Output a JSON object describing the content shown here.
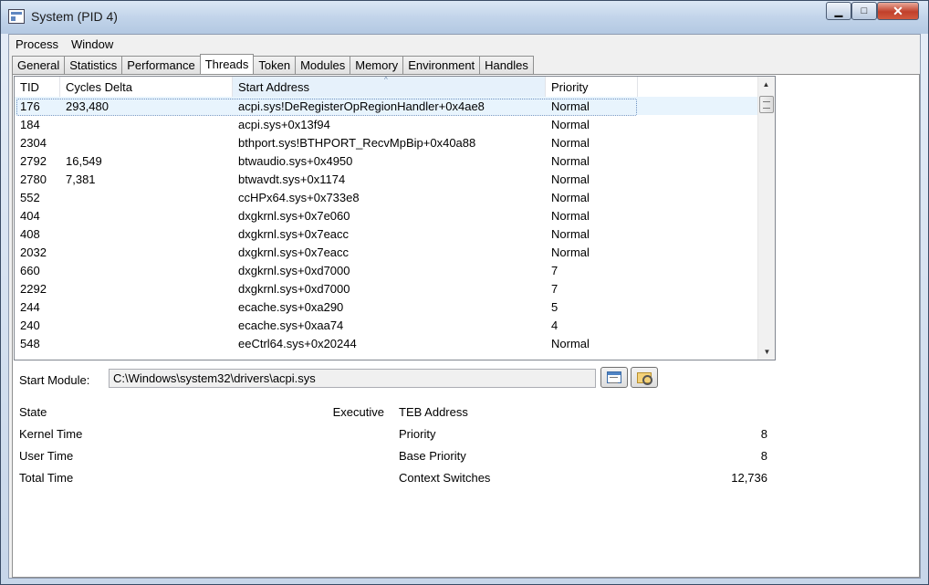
{
  "window": {
    "title": "System (PID 4)",
    "minimize": "▁",
    "maximize": "□",
    "close": "✕"
  },
  "menu": [
    "Process",
    "Window"
  ],
  "tabs": [
    "General",
    "Statistics",
    "Performance",
    "Threads",
    "Token",
    "Modules",
    "Memory",
    "Environment",
    "Handles"
  ],
  "active_tab": "Threads",
  "threads": {
    "columns": [
      "TID",
      "Cycles Delta",
      "Start Address",
      "Priority"
    ],
    "sort_indicator": "^",
    "rows": [
      {
        "tid": "176",
        "cycles": "293,480",
        "address": "acpi.sys!DeRegisterOpRegionHandler+0x4ae8",
        "priority": "Normal"
      },
      {
        "tid": "184",
        "cycles": "",
        "address": "acpi.sys+0x13f94",
        "priority": "Normal"
      },
      {
        "tid": "2304",
        "cycles": "",
        "address": "bthport.sys!BTHPORT_RecvMpBip+0x40a88",
        "priority": "Normal"
      },
      {
        "tid": "2792",
        "cycles": "16,549",
        "address": "btwaudio.sys+0x4950",
        "priority": "Normal"
      },
      {
        "tid": "2780",
        "cycles": "7,381",
        "address": "btwavdt.sys+0x1174",
        "priority": "Normal"
      },
      {
        "tid": "552",
        "cycles": "",
        "address": "ccHPx64.sys+0x733e8",
        "priority": "Normal"
      },
      {
        "tid": "404",
        "cycles": "",
        "address": "dxgkrnl.sys+0x7e060",
        "priority": "Normal"
      },
      {
        "tid": "408",
        "cycles": "",
        "address": "dxgkrnl.sys+0x7eacc",
        "priority": "Normal"
      },
      {
        "tid": "2032",
        "cycles": "",
        "address": "dxgkrnl.sys+0x7eacc",
        "priority": "Normal"
      },
      {
        "tid": "660",
        "cycles": "",
        "address": "dxgkrnl.sys+0xd7000",
        "priority": "7"
      },
      {
        "tid": "2292",
        "cycles": "",
        "address": "dxgkrnl.sys+0xd7000",
        "priority": "7"
      },
      {
        "tid": "244",
        "cycles": "",
        "address": "ecache.sys+0xa290",
        "priority": "5"
      },
      {
        "tid": "240",
        "cycles": "",
        "address": "ecache.sys+0xaa74",
        "priority": "4"
      },
      {
        "tid": "548",
        "cycles": "",
        "address": "eeCtrl64.sys+0x20244",
        "priority": "Normal"
      }
    ],
    "selected_index": 0
  },
  "start_module": {
    "label": "Start Module:",
    "value": "C:\\Windows\\system32\\drivers\\acpi.sys"
  },
  "details": {
    "state_label": "State",
    "state_value": "Executive",
    "kernel_time_label": "Kernel Time",
    "user_time_label": "User Time",
    "total_time_label": "Total Time",
    "teb_label": "TEB Address",
    "priority_label": "Priority",
    "priority_value": "8",
    "base_priority_label": "Base Priority",
    "base_priority_value": "8",
    "context_switches_label": "Context Switches",
    "context_switches_value": "12,736"
  }
}
